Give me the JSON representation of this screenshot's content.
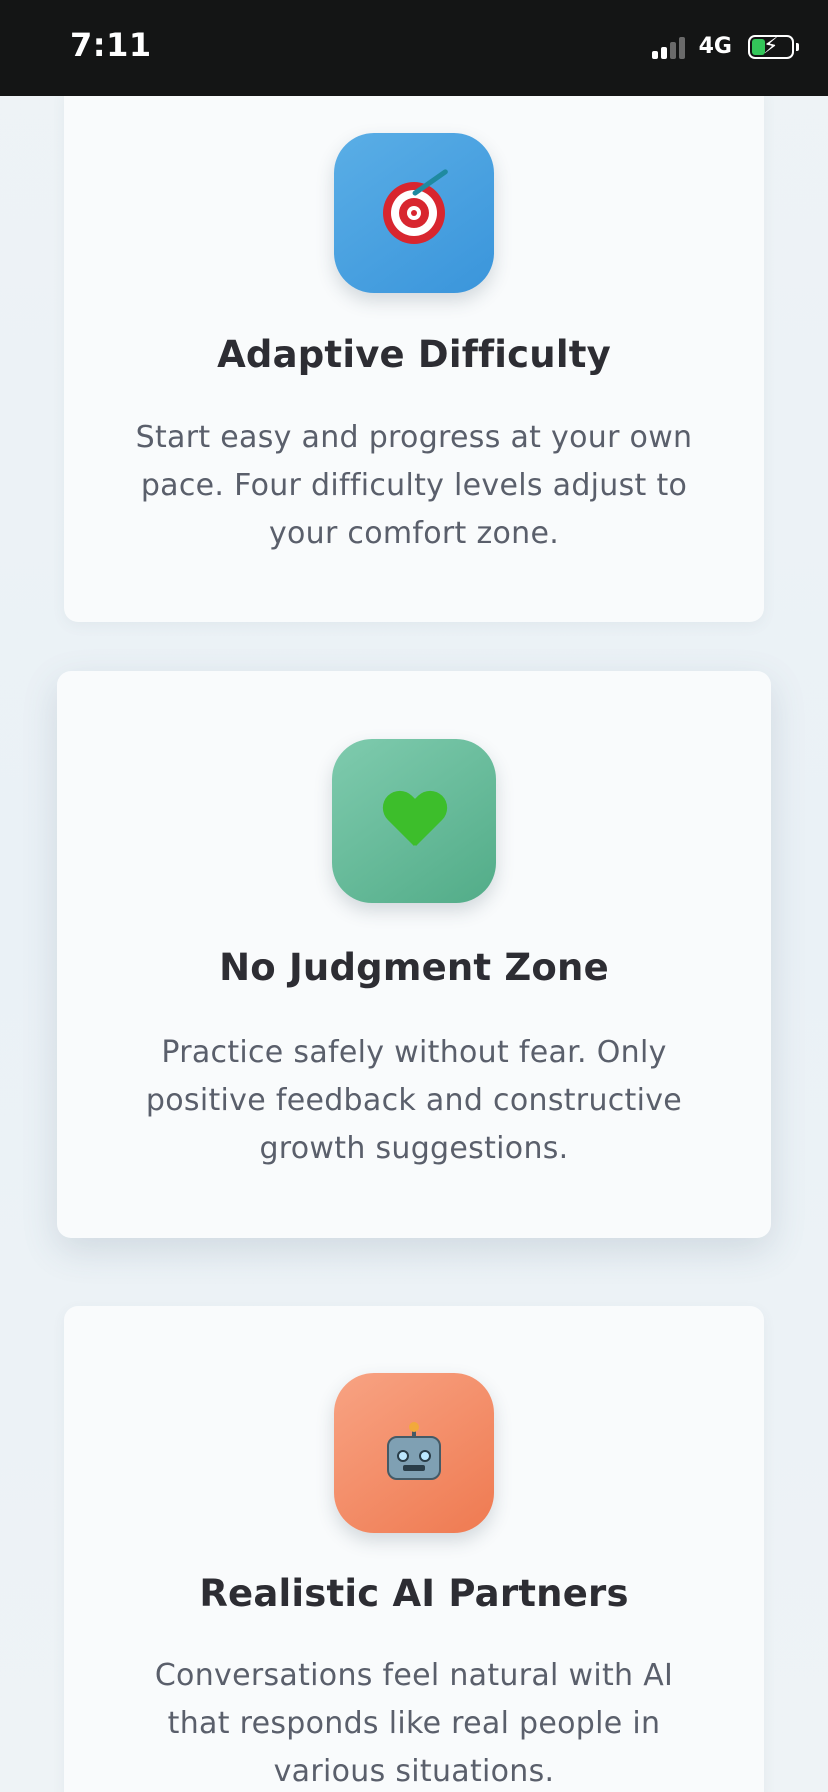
{
  "status_bar": {
    "time": "7:11",
    "network": "4G",
    "battery_state": "charging",
    "icons": [
      "signal-icon",
      "battery-icon"
    ]
  },
  "features": [
    {
      "icon": "target-icon",
      "icon_color": "#3a95db",
      "title": "Adaptive Difficulty",
      "description": "Start easy and progress at your own pace. Four difficulty levels adjust to your comfort zone."
    },
    {
      "icon": "green-heart-icon",
      "icon_color": "#52ac88",
      "title": "No Judgment Zone",
      "description": "Practice safely without fear. Only positive feedback and constructive growth suggestions."
    },
    {
      "icon": "robot-icon",
      "icon_color": "#ef7a51",
      "title": "Realistic AI Partners",
      "description": "Conversations feel natural with AI that responds like real people in various situations."
    }
  ]
}
